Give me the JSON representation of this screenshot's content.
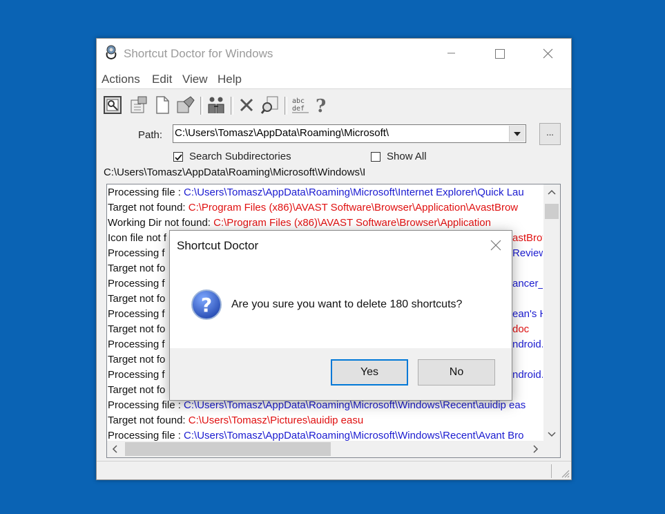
{
  "window": {
    "title": "Shortcut Doctor for Windows"
  },
  "menu": [
    "Actions",
    "Edit",
    "View",
    "Help"
  ],
  "toolbar": {
    "icons": [
      "scan-icon",
      "fix-icon",
      "new-document-icon",
      "move-icon",
      "people-icon",
      "delete-icon",
      "search-icon",
      "abc-def-icon",
      "help-icon"
    ]
  },
  "path": {
    "label": "Path:",
    "value": "C:\\Users\\Tomasz\\AppData\\Roaming\\Microsoft\\",
    "browse_label": "..."
  },
  "options": {
    "search_subdirectories": {
      "label": "Search Subdirectories",
      "checked": true
    },
    "show_all": {
      "label": "Show All",
      "checked": false
    }
  },
  "current_path": "C:\\Users\\Tomasz\\AppData\\Roaming\\Microsoft\\Windows\\I",
  "log": [
    {
      "prefix": "Processing file : ",
      "path": "C:\\Users\\Tomasz\\AppData\\Roaming\\Microsoft\\Internet Explorer\\Quick Lau",
      "color": "blue"
    },
    {
      "prefix": "Target not found: ",
      "path": "C:\\Program Files (x86)\\AVAST Software\\Browser\\Application\\AvastBrow",
      "color": "red"
    },
    {
      "prefix": "Working Dir not found: ",
      "path": "C:\\Program Files (x86)\\AVAST Software\\Browser\\Application",
      "color": "red"
    },
    {
      "prefix": "Icon file not f",
      "path": "",
      "tail": "astBrov",
      "color": "red"
    },
    {
      "prefix": "Processing f",
      "path": "",
      "tail": "Review",
      "color": "blue"
    },
    {
      "prefix": "Target not fo",
      "path": "",
      "tail": "",
      "color": "red"
    },
    {
      "prefix": "Processing f",
      "path": "",
      "tail": "ancer_",
      "color": "blue"
    },
    {
      "prefix": "Target not fo",
      "path": "",
      "tail": "",
      "color": "red"
    },
    {
      "prefix": "Processing f",
      "path": "",
      "tail": "ean's H",
      "color": "blue"
    },
    {
      "prefix": "Target not fo",
      "path": "",
      "tail": "doc",
      "color": "red"
    },
    {
      "prefix": "Processing f",
      "path": "",
      "tail": "ndroid.lr",
      "color": "blue"
    },
    {
      "prefix": "Target not fo",
      "path": "",
      "tail": "",
      "color": "red"
    },
    {
      "prefix": "Processing f",
      "path": "",
      "tail": "ndroid.z",
      "color": "blue"
    },
    {
      "prefix": "Target not fo",
      "path": "",
      "tail": "",
      "color": "red"
    },
    {
      "prefix": "Processing file : ",
      "path": "C:\\Users\\Tomasz\\AppData\\Roaming\\Microsoft\\Windows\\Recent\\auidip eas",
      "color": "blue"
    },
    {
      "prefix": "Target not found: ",
      "path": "C:\\Users\\Tomasz\\Pictures\\auidip easu",
      "color": "red"
    },
    {
      "prefix": "Processing file : ",
      "path": "C:\\Users\\Tomasz\\AppData\\Roaming\\Microsoft\\Windows\\Recent\\Avant Bro",
      "color": "blue"
    }
  ],
  "dialog": {
    "title": "Shortcut Doctor",
    "message": "Are you sure you want to delete 180 shortcuts?",
    "yes_label": "Yes",
    "no_label": "No"
  }
}
